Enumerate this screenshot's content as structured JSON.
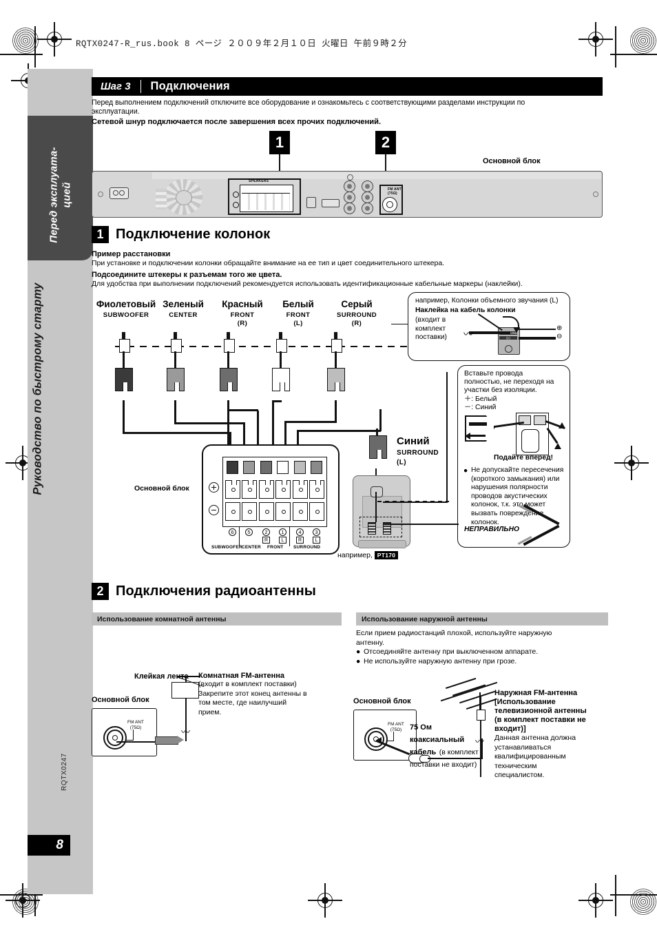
{
  "print_header": {
    "book_line": "RQTX0247-R_rus.book   8 ページ   ２００９年２月１０日   火曜日   午前９時２分"
  },
  "sidebar": {
    "tab_label": "Перед эксплуата-\nцией",
    "band_label": "Руководство по быстрому старту",
    "doc_code": "RQTX0247",
    "page_number": "8"
  },
  "step_header": {
    "step_label": "Шаг 3",
    "title": "Подключения"
  },
  "intro": {
    "line1": "Перед выполнением подключений отключите все оборудование и ознакомьтесь с соответствующими разделами инструкции по",
    "line2": "эксплуатации.",
    "bold": "Сетевой шнур подключается после завершения всех прочих подключений."
  },
  "rear_panel": {
    "callout_1": "1",
    "callout_2": "2",
    "main_unit_label": "Основной блок",
    "speakers_label": "SPEAKERS",
    "fm_ant_label": "FM ANT",
    "fm_ant_ohm": "(75Ω)"
  },
  "section1": {
    "number": "1",
    "title": "Подключение колонок",
    "sub1_bold": "Пример расстановки",
    "sub1_text": "При установке и подключении колонки обращайте внимание на ее тип и цвет соединительного штекера.",
    "sub2_bold": "Подсоедините штекеры к разъемам того же цвета.",
    "sub2_text": "Для удобства при выполнении подключений рекомендуется использовать идентификационные кабельные маркеры (наклейки)."
  },
  "speaker_columns": [
    {
      "color_name": "Фиолетовый",
      "role": "SUBWOOFER",
      "channel": "",
      "swatch": "#3a3a3a",
      "plug_fill": "#3a3a3a"
    },
    {
      "color_name": "Зеленый",
      "role": "CENTER",
      "channel": "",
      "swatch": "#9a9a9a",
      "plug_fill": "#9a9a9a"
    },
    {
      "color_name": "Красный",
      "role": "FRONT",
      "channel": "(R)",
      "swatch": "#6d6d6d",
      "plug_fill": "#6d6d6d"
    },
    {
      "color_name": "Белый",
      "role": "FRONT",
      "channel": "(L)",
      "swatch": "#ffffff",
      "plug_fill": "#ffffff"
    },
    {
      "color_name": "Серый",
      "role": "SURROUND",
      "channel": "(R)",
      "swatch": "#bdbdbd",
      "plug_fill": "#bdbdbd"
    }
  ],
  "blue_speaker": {
    "color_name": "Синий",
    "role": "SURROUND",
    "channel": "(L)",
    "example_label": "например,",
    "model_badge": "PT170"
  },
  "terminal_block": {
    "main_unit_label": "Основной блок",
    "groups": [
      {
        "num": "6",
        "lr": "",
        "name": "SUBWOOFER"
      },
      {
        "num": "5",
        "lr": "",
        "name": "CENTER"
      },
      {
        "num": "2",
        "lr": "R",
        "name": "FRONT"
      },
      {
        "num": "1",
        "lr": "L",
        "name": ""
      },
      {
        "num": "4",
        "lr": "R",
        "name": "SURROUND"
      },
      {
        "num": "3",
        "lr": "L",
        "name": ""
      }
    ]
  },
  "callout_sticker": {
    "line1": "например, Колонки объемного звучания (L)",
    "bold": "Наклейка на кабель колонки",
    "note": "(входит в\nкомплект\nпоставки)",
    "sticker_text1": "SURROUND",
    "sticker_text2": "(L)",
    "plus": "⊕",
    "minus": "⊖"
  },
  "callout_insert": {
    "line1": "Вставьте провода",
    "line2": "полностью, не переходя на",
    "line3": "участки без изоляции.",
    "plus_line": "＋: Белый",
    "minus_line": "－: Синий",
    "push": "Подайте вперед!",
    "warning": "Не допускайте пересечения (короткого замыкания) или нарушения полярности проводов акустических колонок, т.к. это может вызвать повреждение колонок.",
    "wrong_label": "НЕПРАВИЛЬНО"
  },
  "section2": {
    "number": "2",
    "title": "Подключения радиоантенны",
    "left_subbar": "Использование комнатной антенны",
    "right_subbar": "Использование наружной антенны"
  },
  "indoor_antenna": {
    "tape_label": "Клейкая лента",
    "main_unit_label": "Основной блок",
    "fm_ant": "FM ANT",
    "fm_ohm": "(75Ω)",
    "title": "Комнатная FM-антенна",
    "body": "(входит в комплект поставки)\nЗакрепите этот конец антенны в\nтом месте, где наилучший\nприем."
  },
  "outdoor_antenna": {
    "intro1": "Если прием радиостанций плохой, используйте наружную",
    "intro2": "антенну.",
    "bullet1": "Отсоединяйте антенну при выключенном аппарате.",
    "bullet2": "Не используйте наружную антенну при грозе.",
    "main_unit_label": "Основной блок",
    "fm_ant": "FM ANT",
    "fm_ohm": "(75Ω)",
    "coax_bold": "75 Ом\nкоаксиальный\nкабель",
    "coax_note": "(в комплект\nпоставки не входит)",
    "title": "Наружная FM-антенна\n[Использование\nтелевизионной антенны\n(в комплект поставки не\nвходит)]",
    "body": "Данная антенна должна\nустанавливаться\nквалифицированным\nтехническим\nспециалистом."
  }
}
